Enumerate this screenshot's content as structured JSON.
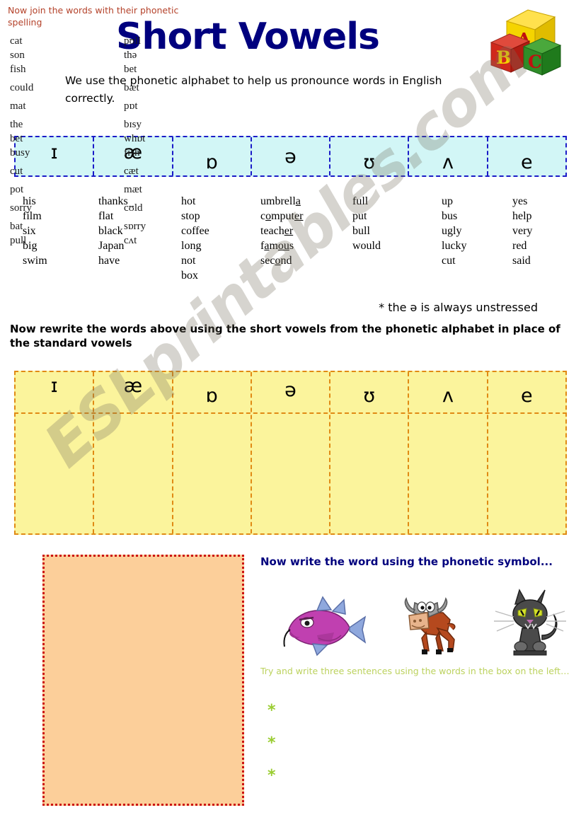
{
  "header": {
    "title": "Short Vowels",
    "logo_icon": "abc-blocks-icon",
    "logo_letters": [
      "A",
      "B",
      "C"
    ],
    "intro": "We use the phonetic alphabet to help us pronounce words in English correctly."
  },
  "symbol_row": {
    "symbols": [
      "ɪ",
      "æ",
      "ɒ",
      "ə",
      "ʊ",
      "ʌ",
      "e"
    ],
    "background_color": "#d2f6f6",
    "border_color": "#1b1bc8"
  },
  "word_columns": [
    {
      "symbol": "ɪ",
      "words": [
        "his",
        "film",
        "six",
        "big",
        "swim"
      ]
    },
    {
      "symbol": "æ",
      "words": [
        "thanks",
        "flat",
        "black",
        "Japan",
        "have"
      ]
    },
    {
      "symbol": "ɒ",
      "words": [
        "hot",
        "stop",
        "coffee",
        "long",
        "not",
        "box"
      ]
    },
    {
      "symbol": "ə",
      "words_html": [
        "umbrell<u>a</u>",
        "c<u>o</u>mput<u>er</u>",
        "teach<u>er</u>",
        "f<u>a</u>m<u>ou</u>s",
        "sec<u>o</u>nd"
      ]
    },
    {
      "symbol": "ʊ",
      "words": [
        "full",
        "put",
        "bull",
        "would"
      ]
    },
    {
      "symbol": "ʌ",
      "words": [
        "up",
        "bus",
        "ugly",
        "lucky",
        "cut"
      ]
    },
    {
      "symbol": "e",
      "words": [
        "yes",
        "help",
        "very",
        "red",
        "said"
      ]
    }
  ],
  "notes": {
    "schwa": "* the ə is always unstressed",
    "rewrite": "Now rewrite the words above using the short vowels from the phonetic alphabet in place of the standard vowels"
  },
  "answer_table": {
    "symbols": [
      "ɪ",
      "æ",
      "ɒ",
      "ə",
      "ʊ",
      "ʌ",
      "e"
    ],
    "background_color": "#fbf49c",
    "border_color": "#e08a14",
    "rows_blank": 1
  },
  "match_box": {
    "heading": "Now join the words with their phonetic spelling",
    "background_color": "#fccf9a",
    "border_color": "#cc1111",
    "heading_color": "#b4422a",
    "left_words": [
      "cat",
      "son",
      "fish",
      "could",
      "mat",
      "the",
      "bet",
      "busy",
      "cut",
      "pot",
      "sorry",
      "bat",
      "pull"
    ],
    "right_words": [
      "pʊll",
      "thə",
      "bet",
      "bæt",
      "pɒt",
      "bɪsy",
      "whɒt",
      "fɪsh",
      "cæt",
      "mæt",
      "cʊld",
      "sɒrry",
      "cʌt"
    ]
  },
  "picture_task": {
    "heading": "Now write the word using the phonetic symbol...",
    "heading_color": "#00007e",
    "pictures": [
      {
        "icon": "fish-icon",
        "label": "fish",
        "color": "#c040b0"
      },
      {
        "icon": "bull-icon",
        "label": "bull",
        "color": "#a8441a"
      },
      {
        "icon": "cat-icon",
        "label": "cat",
        "color": "#4a4a4a"
      }
    ]
  },
  "sentence_task": {
    "text": "Try and write three sentences using the words in the box on the left…",
    "text_color": "#bcd25e",
    "bullets": [
      "*",
      "*",
      "*"
    ],
    "bullet_color": "#9acd32"
  },
  "watermark": {
    "text": "ESLprintables.com"
  }
}
